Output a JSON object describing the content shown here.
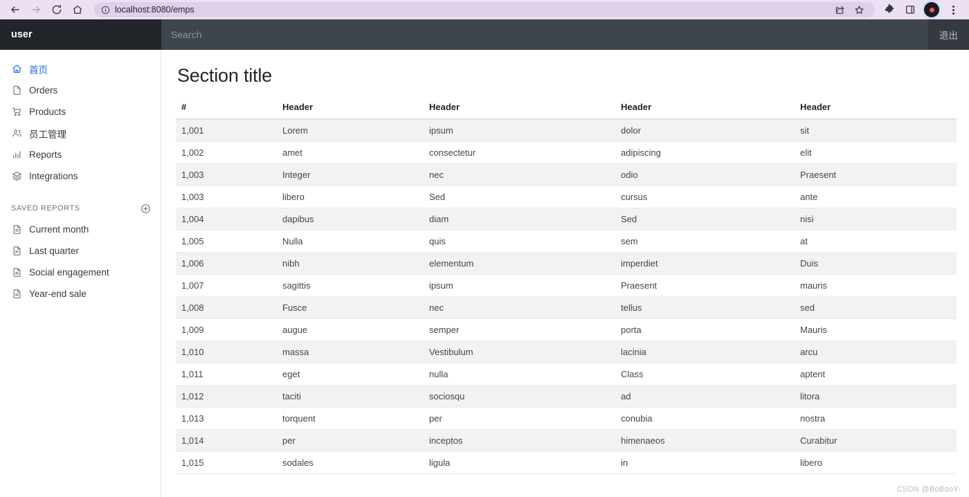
{
  "browser": {
    "back_icon": "back-arrow-icon",
    "forward_icon": "forward-arrow-icon",
    "reload_icon": "reload-icon",
    "home_icon": "home-icon",
    "site_info_icon": "site-info-icon",
    "url": "localhost:8080/emps",
    "share_icon": "share-icon",
    "bookmark_icon": "star-icon",
    "extensions_icon": "puzzle-icon",
    "sidepanel_icon": "side-panel-icon",
    "profile_icon": "profile-avatar-icon",
    "menu_icon": "three-dot-menu-icon"
  },
  "navbar": {
    "brand": "user",
    "search_placeholder": "Search",
    "search_value": "",
    "logout_label": "退出"
  },
  "sidebar": {
    "items": [
      {
        "label": "首页",
        "icon": "home-icon",
        "active": true
      },
      {
        "label": "Orders",
        "icon": "file-icon",
        "active": false
      },
      {
        "label": "Products",
        "icon": "cart-icon",
        "active": false
      },
      {
        "label": "员工管理",
        "icon": "people-icon",
        "active": false
      },
      {
        "label": "Reports",
        "icon": "bar-chart-icon",
        "active": false
      },
      {
        "label": "Integrations",
        "icon": "layers-icon",
        "active": false
      }
    ],
    "saved_reports": {
      "heading": "Saved reports",
      "add_icon": "plus-circle-icon",
      "items": [
        {
          "label": "Current month",
          "icon": "file-text-icon"
        },
        {
          "label": "Last quarter",
          "icon": "file-text-icon"
        },
        {
          "label": "Social engagement",
          "icon": "file-text-icon"
        },
        {
          "label": "Year-end sale",
          "icon": "file-text-icon"
        }
      ]
    }
  },
  "main": {
    "title": "Section title",
    "table": {
      "headers": [
        "#",
        "Header",
        "Header",
        "Header",
        "Header"
      ],
      "rows": [
        [
          "1,001",
          "Lorem",
          "ipsum",
          "dolor",
          "sit"
        ],
        [
          "1,002",
          "amet",
          "consectetur",
          "adipiscing",
          "elit"
        ],
        [
          "1,003",
          "Integer",
          "nec",
          "odio",
          "Praesent"
        ],
        [
          "1,003",
          "libero",
          "Sed",
          "cursus",
          "ante"
        ],
        [
          "1,004",
          "dapibus",
          "diam",
          "Sed",
          "nisi"
        ],
        [
          "1,005",
          "Nulla",
          "quis",
          "sem",
          "at"
        ],
        [
          "1,006",
          "nibh",
          "elementum",
          "imperdiet",
          "Duis"
        ],
        [
          "1,007",
          "sagittis",
          "ipsum",
          "Praesent",
          "mauris"
        ],
        [
          "1,008",
          "Fusce",
          "nec",
          "tellus",
          "sed"
        ],
        [
          "1,009",
          "augue",
          "semper",
          "porta",
          "Mauris"
        ],
        [
          "1,010",
          "massa",
          "Vestibulum",
          "lacinia",
          "arcu"
        ],
        [
          "1,011",
          "eget",
          "nulla",
          "Class",
          "aptent"
        ],
        [
          "1,012",
          "taciti",
          "sociosqu",
          "ad",
          "litora"
        ],
        [
          "1,013",
          "torquent",
          "per",
          "conubia",
          "nostra"
        ],
        [
          "1,014",
          "per",
          "inceptos",
          "himenaeos",
          "Curabitur"
        ],
        [
          "1,015",
          "sodales",
          "ligula",
          "in",
          "libero"
        ]
      ]
    }
  },
  "watermark": "CSDN @BoBooY-",
  "colors": {
    "navbar_bg": "#343a40",
    "brand_bg": "#212529",
    "active_link": "#0d6efd",
    "omnibox_bg": "#ded0e8",
    "browser_bar_bg": "#ece1f2",
    "row_stripe": "#f2f2f2"
  }
}
